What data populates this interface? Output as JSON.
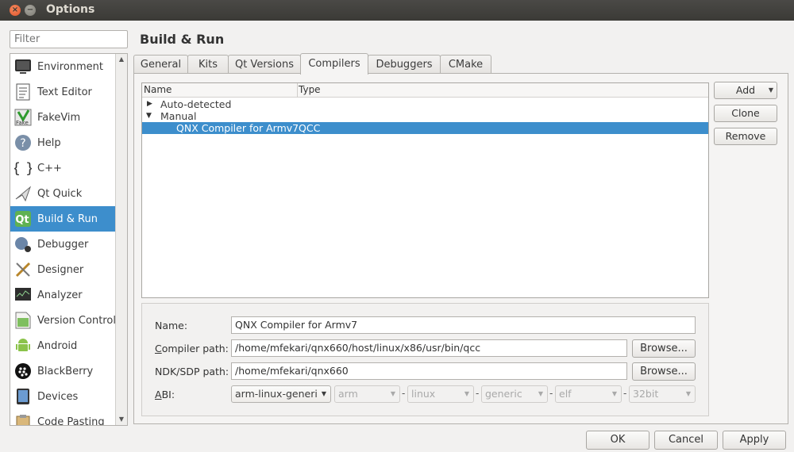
{
  "window": {
    "title": "Options"
  },
  "filter": {
    "placeholder": "Filter"
  },
  "categories": [
    {
      "label": "Environment",
      "icon": "monitor-icon"
    },
    {
      "label": "Text Editor",
      "icon": "text-editor-icon"
    },
    {
      "label": "FakeVim",
      "icon": "fakevim-icon"
    },
    {
      "label": "Help",
      "icon": "help-icon"
    },
    {
      "label": "C++",
      "icon": "braces-icon"
    },
    {
      "label": "Qt Quick",
      "icon": "qt-quick-icon"
    },
    {
      "label": "Build & Run",
      "icon": "build-run-icon",
      "selected": true
    },
    {
      "label": "Debugger",
      "icon": "debugger-icon"
    },
    {
      "label": "Designer",
      "icon": "designer-icon"
    },
    {
      "label": "Analyzer",
      "icon": "analyzer-icon"
    },
    {
      "label": "Version Control",
      "icon": "version-control-icon"
    },
    {
      "label": "Android",
      "icon": "android-icon"
    },
    {
      "label": "BlackBerry",
      "icon": "blackberry-icon"
    },
    {
      "label": "Devices",
      "icon": "devices-icon"
    },
    {
      "label": "Code Pasting",
      "icon": "code-pasting-icon"
    }
  ],
  "page": {
    "title": "Build & Run"
  },
  "tabs": [
    "General",
    "Kits",
    "Qt Versions",
    "Compilers",
    "Debuggers",
    "CMake"
  ],
  "active_tab": "Compilers",
  "tree": {
    "columns": [
      "Name",
      "Type"
    ],
    "groups": [
      {
        "label": "Auto-detected",
        "expanded": false
      },
      {
        "label": "Manual",
        "expanded": true
      }
    ],
    "selected_row": {
      "name": "QNX Compiler for Armv7",
      "type": "QCC"
    }
  },
  "buttons": {
    "add": "Add",
    "clone": "Clone",
    "remove": "Remove"
  },
  "details": {
    "name_label": "Name:",
    "name_value": "QNX Compiler for Armv7",
    "compiler_path_label": "Compiler path:",
    "compiler_path_value": "/home/mfekari/qnx660/host/linux/x86/usr/bin/qcc",
    "ndk_label": "NDK/SDP path:",
    "ndk_value": "/home/mfekari/qnx660",
    "browse": "Browse...",
    "abi_label": "ABI:",
    "abi_main": "arm-linux-generi",
    "abi_arch": "arm",
    "abi_os": "linux",
    "abi_flavor": "generic",
    "abi_format": "elf",
    "abi_width": "32bit"
  },
  "footer": {
    "ok": "OK",
    "cancel": "Cancel",
    "apply": "Apply"
  },
  "colors": {
    "selection": "#3d8ecc",
    "titlebar": "#3b3a36",
    "close": "#e2532c"
  }
}
